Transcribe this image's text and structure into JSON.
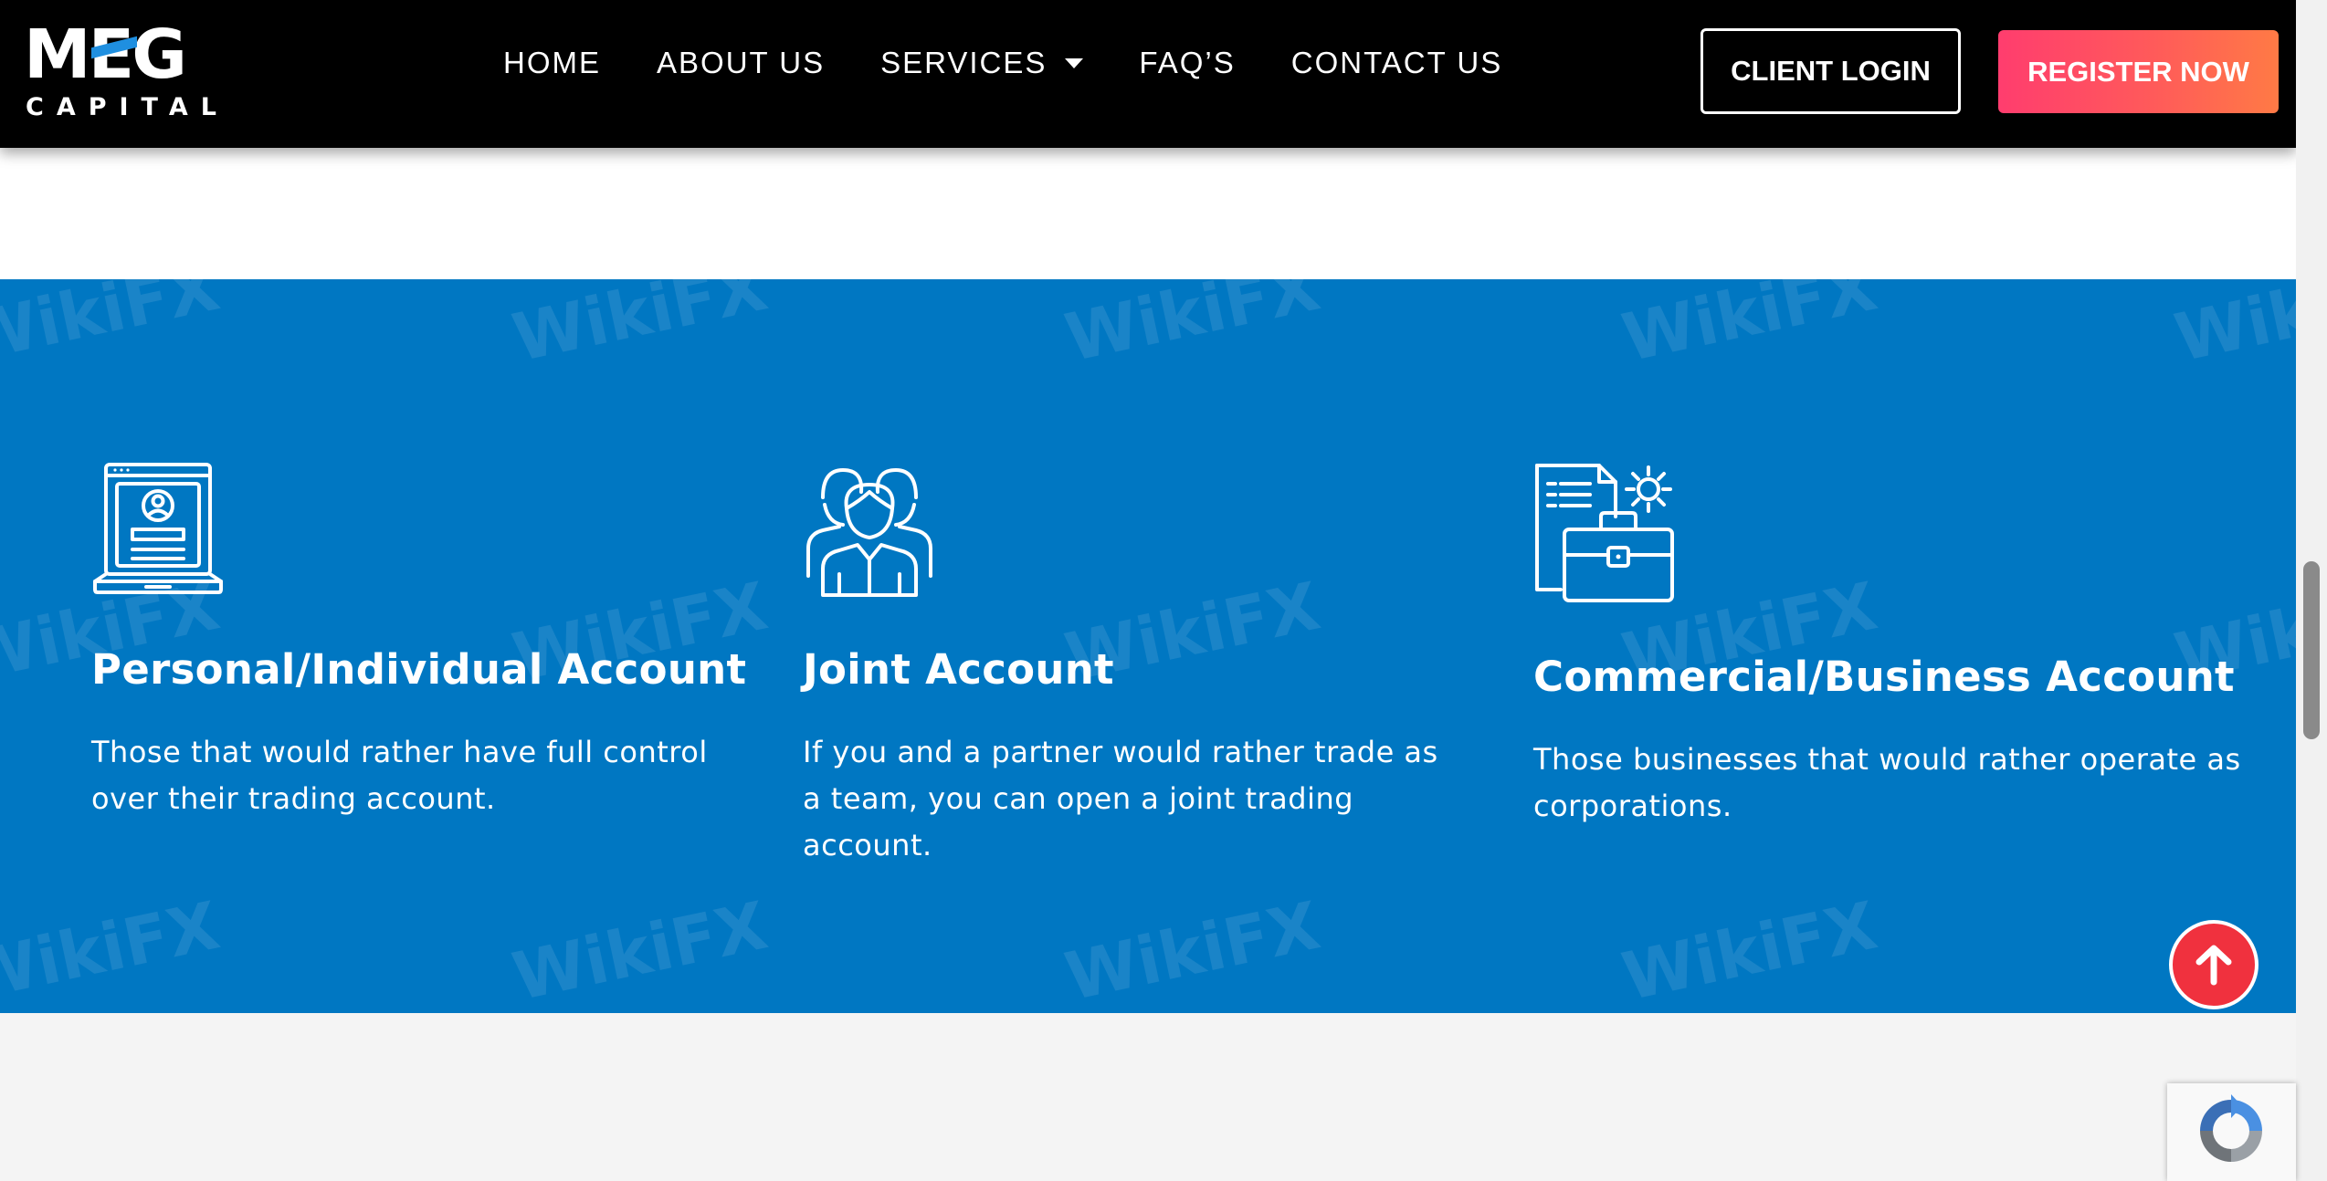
{
  "header": {
    "logo": {
      "main": "MEG",
      "sub": "CAPITAL"
    },
    "nav": [
      {
        "label": "HOME"
      },
      {
        "label": "ABOUT US"
      },
      {
        "label": "SERVICES",
        "has_dropdown": true
      },
      {
        "label": "FAQ’S"
      },
      {
        "label": "CONTACT US"
      }
    ],
    "client_login": "CLIENT LOGIN",
    "register_now": "REGISTER NOW"
  },
  "accounts": [
    {
      "icon": "laptop-profile-icon",
      "title": "Personal/Individual Account",
      "description": "Those that would rather have full control over their trading account."
    },
    {
      "icon": "group-people-icon",
      "title": "Joint Account",
      "description": "If you and a partner would rather trade as a team, you can open a joint trading account."
    },
    {
      "icon": "briefcase-document-icon",
      "title": "Commercial/Business Account",
      "description": "Those businesses that would rather operate as corporations."
    }
  ],
  "watermark": "WikiFX",
  "floating": {
    "back_to_top_icon": "arrow-up-icon",
    "recaptcha_icon": "recaptcha-icon"
  },
  "colors": {
    "header_bg": "#000000",
    "section_blue": "#0077c2",
    "register_gradient_start": "#ff3d6e",
    "register_gradient_end": "#ff7a45",
    "back_to_top": "#f0313e",
    "logo_accent": "#1f8fe0"
  }
}
